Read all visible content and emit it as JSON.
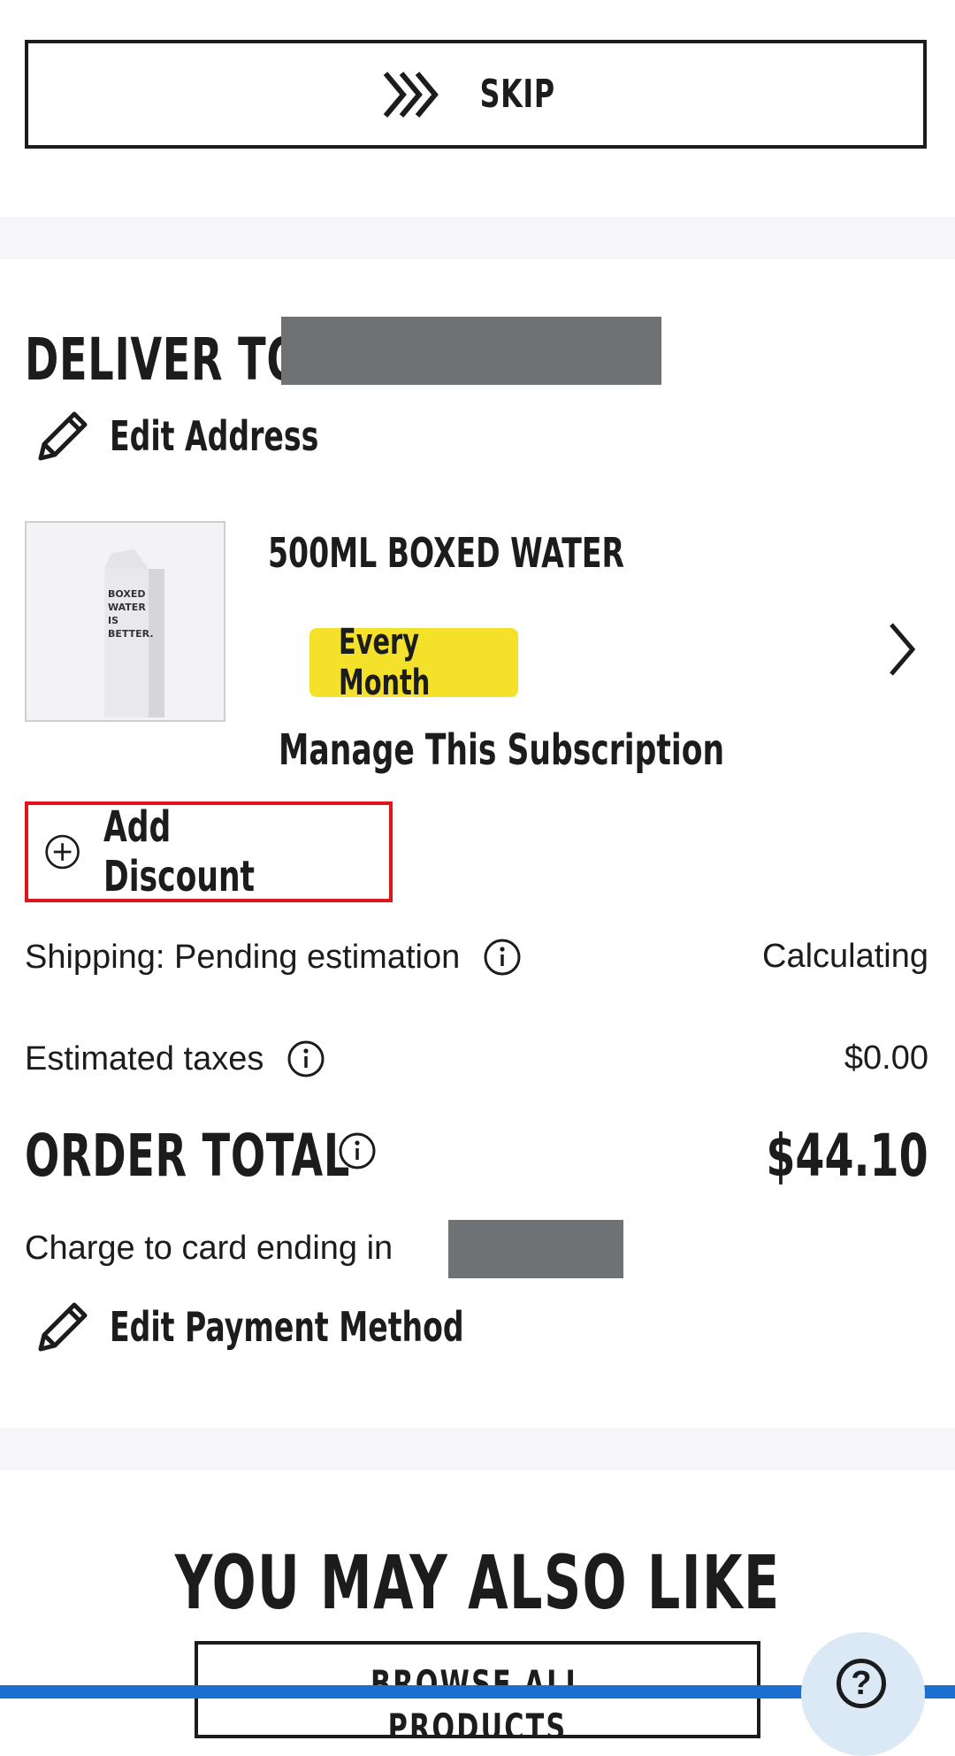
{
  "skip": {
    "label": "SKIP",
    "icon": "fast-forward-chevrons-icon"
  },
  "delivery": {
    "heading": "DELIVER TO",
    "edit_address_label": "Edit Address"
  },
  "product": {
    "name": "500ML BOXED WATER",
    "frequency": "Every Month",
    "manage_label": "Manage This Subscription",
    "image_text": [
      "BOXED",
      "WATER",
      "IS",
      "BETTER."
    ]
  },
  "discount": {
    "label": "Add Discount"
  },
  "summary": {
    "shipping_label": "Shipping: Pending estimation",
    "shipping_value": "Calculating",
    "taxes_label": "Estimated taxes",
    "taxes_value": "$0.00",
    "order_total_label": "ORDER TOTAL",
    "order_total_value": "$44.10"
  },
  "payment": {
    "charge_label": "Charge to card ending in",
    "edit_payment_label": "Edit Payment Method"
  },
  "recommendations": {
    "heading": "YOU MAY ALSO LIKE",
    "browse_label": "BROWSE ALL PRODUCTS"
  },
  "help": {
    "label": "?"
  },
  "colors": {
    "highlight_border": "#e0141b",
    "badge_yellow": "#f4e12a",
    "redaction_gray": "#6f7274",
    "bottom_bar_blue": "#1a6fd1"
  }
}
